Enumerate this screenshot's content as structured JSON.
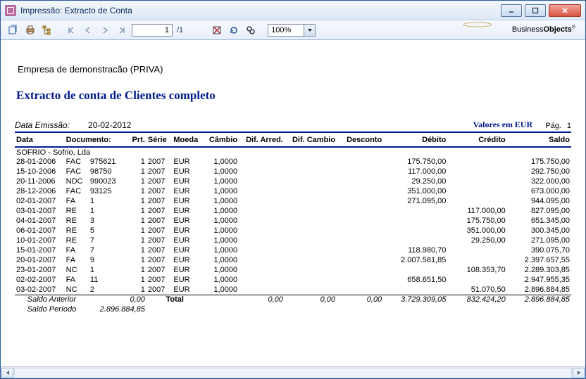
{
  "window": {
    "title": "Impressão: Extracto de Conta"
  },
  "toolbar": {
    "page_current": "1",
    "page_total": "/1",
    "zoom": "100%",
    "brand1": "Business",
    "brand2": "Objects"
  },
  "report": {
    "company": "Empresa de demonstracão (PRIVA)",
    "headline": "Extracto de conta de Clientes  completo",
    "meta": {
      "issue_label": "Data Emissão:",
      "issue_date": "20-02-2012",
      "currency_label": "Valores em EUR",
      "page_label": "Pág.",
      "page_number": "1"
    },
    "headers": {
      "data": "Data",
      "documento": "Documento:",
      "prt": "Prt.",
      "serie": "Série",
      "moeda": "Moeda",
      "cambio": "Câmbio",
      "dif_arred": "Dif. Arred.",
      "dif_cambio": "Dif. Cambio",
      "desconto": "Desconto",
      "debito": "Débito",
      "credito": "Crédito",
      "saldo": "Saldo"
    },
    "client": "SOFRIO - Sofrio, Lda",
    "rows": [
      {
        "data": "28-01-2006",
        "docT": "FAC",
        "docN": "975621",
        "prt": "1",
        "serie": "2007",
        "moeda": "EUR",
        "cambio": "1,0000",
        "debito": "175.750,00",
        "credito": "",
        "saldo": "175.750,00"
      },
      {
        "data": "15-10-2006",
        "docT": "FAC",
        "docN": "98750",
        "prt": "1",
        "serie": "2007",
        "moeda": "EUR",
        "cambio": "1,0000",
        "debito": "117.000,00",
        "credito": "",
        "saldo": "292.750,00"
      },
      {
        "data": "20-11-2006",
        "docT": "NDC",
        "docN": "990023",
        "prt": "1",
        "serie": "2007",
        "moeda": "EUR",
        "cambio": "1,0000",
        "debito": "29.250,00",
        "credito": "",
        "saldo": "322.000,00"
      },
      {
        "data": "28-12-2006",
        "docT": "FAC",
        "docN": "93125",
        "prt": "1",
        "serie": "2007",
        "moeda": "EUR",
        "cambio": "1,0000",
        "debito": "351.000,00",
        "credito": "",
        "saldo": "673.000,00"
      },
      {
        "data": "02-01-2007",
        "docT": "FA",
        "docN": "1",
        "prt": "1",
        "serie": "2007",
        "moeda": "EUR",
        "cambio": "1,0000",
        "debito": "271.095,00",
        "credito": "",
        "saldo": "944.095,00"
      },
      {
        "data": "03-01-2007",
        "docT": "RE",
        "docN": "1",
        "prt": "1",
        "serie": "2007",
        "moeda": "EUR",
        "cambio": "1,0000",
        "debito": "",
        "credito": "117.000,00",
        "saldo": "827.095,00"
      },
      {
        "data": "04-01-2007",
        "docT": "RE",
        "docN": "3",
        "prt": "1",
        "serie": "2007",
        "moeda": "EUR",
        "cambio": "1,0000",
        "debito": "",
        "credito": "175.750,00",
        "saldo": "651.345,00"
      },
      {
        "data": "06-01-2007",
        "docT": "RE",
        "docN": "5",
        "prt": "1",
        "serie": "2007",
        "moeda": "EUR",
        "cambio": "1,0000",
        "debito": "",
        "credito": "351.000,00",
        "saldo": "300.345,00"
      },
      {
        "data": "10-01-2007",
        "docT": "RE",
        "docN": "7",
        "prt": "1",
        "serie": "2007",
        "moeda": "EUR",
        "cambio": "1,0000",
        "debito": "",
        "credito": "29.250,00",
        "saldo": "271.095,00"
      },
      {
        "data": "15-01-2007",
        "docT": "FA",
        "docN": "7",
        "prt": "1",
        "serie": "2007",
        "moeda": "EUR",
        "cambio": "1,0000",
        "debito": "118.980,70",
        "credito": "",
        "saldo": "390.075,70"
      },
      {
        "data": "20-01-2007",
        "docT": "FA",
        "docN": "9",
        "prt": "1",
        "serie": "2007",
        "moeda": "EUR",
        "cambio": "1,0000",
        "debito": "2.007.581,85",
        "credito": "",
        "saldo": "2.397.657,55"
      },
      {
        "data": "23-01-2007",
        "docT": "NC",
        "docN": "1",
        "prt": "1",
        "serie": "2007",
        "moeda": "EUR",
        "cambio": "1,0000",
        "debito": "",
        "credito": "108.353,70",
        "saldo": "2.289.303,85"
      },
      {
        "data": "02-02-2007",
        "docT": "FA",
        "docN": "11",
        "prt": "1",
        "serie": "2007",
        "moeda": "EUR",
        "cambio": "1,0000",
        "debito": "658.651,50",
        "credito": "",
        "saldo": "2.947.955,35"
      },
      {
        "data": "03-02-2007",
        "docT": "NC",
        "docN": "2",
        "prt": "1",
        "serie": "2007",
        "moeda": "EUR",
        "cambio": "1,0000",
        "debito": "",
        "credito": "51.070,50",
        "saldo": "2.896.884,85"
      }
    ],
    "totals": {
      "saldo_anterior_label": "Saldo Anterior",
      "saldo_anterior_val": "0,00",
      "total_label": "Total",
      "dif_arred": "0,00",
      "dif_cambio": "0,00",
      "desconto": "0,00",
      "debito": "3.729.309,05",
      "credito": "832.424,20",
      "saldo": "2.896.884,85",
      "saldo_periodo_label": "Saldo Período",
      "saldo_periodo_val": "2.896.884,85"
    }
  }
}
